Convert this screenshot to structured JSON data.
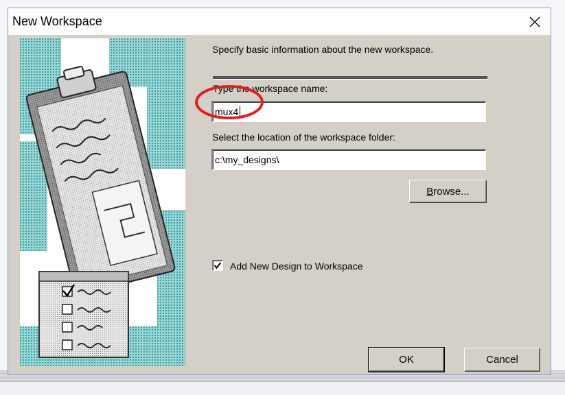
{
  "dialog": {
    "title": "New Workspace",
    "close_icon": "close-icon"
  },
  "form": {
    "intro": "Specify basic information about the new workspace.",
    "name_label": "Type the workspace name:",
    "name_value": "mux4",
    "location_label": "Select the location of the workspace folder:",
    "location_value": "c:\\my_designs\\",
    "browse_label": "Browse...",
    "add_design_label": "Add New Design to Workspace",
    "add_design_checked": true
  },
  "buttons": {
    "ok": "OK",
    "cancel": "Cancel"
  },
  "colors": {
    "annotation_circle": "#e02020",
    "art_teal": "#2fa6a6"
  }
}
